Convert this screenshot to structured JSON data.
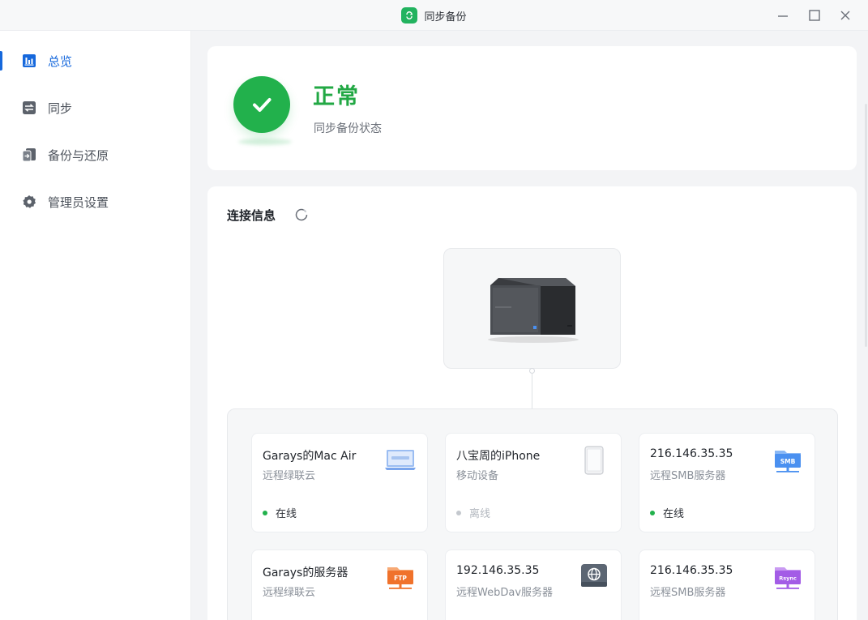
{
  "window": {
    "title": "同步备份",
    "controls": [
      "minimize-icon",
      "maximize-icon",
      "close-icon"
    ]
  },
  "sidebar": {
    "items": [
      {
        "label": "总览",
        "icon": "chart-icon",
        "active": true
      },
      {
        "label": "同步",
        "icon": "sync-icon",
        "active": false
      },
      {
        "label": "备份与还原",
        "icon": "backup-icon",
        "active": false
      },
      {
        "label": "管理员设置",
        "icon": "gear-icon",
        "active": false
      }
    ]
  },
  "status": {
    "value": "正常",
    "caption": "同步备份状态",
    "color": "#22b14c"
  },
  "connection": {
    "title": "连接信息",
    "devices": [
      {
        "name": "Garays的Mac Air",
        "type": "远程绿联云",
        "status": "在线",
        "online": true,
        "icon": "laptop-icon"
      },
      {
        "name": "八宝周的iPhone",
        "type": "移动设备",
        "status": "离线",
        "online": false,
        "icon": "phone-icon"
      },
      {
        "name": "216.146.35.35",
        "type": "远程SMB服务器",
        "status": "在线",
        "online": true,
        "icon": "smb-folder-icon",
        "badge": "SMB"
      },
      {
        "name": "Garays的服务器",
        "type": "远程绿联云",
        "status": "",
        "online": true,
        "icon": "ftp-folder-icon",
        "badge": "FTP"
      },
      {
        "name": "192.146.35.35",
        "type": "远程WebDav服务器",
        "status": "",
        "online": true,
        "icon": "globe-icon"
      },
      {
        "name": "216.146.35.35",
        "type": "远程SMB服务器",
        "status": "",
        "online": true,
        "icon": "rsync-folder-icon",
        "badge": "Rsync"
      }
    ]
  },
  "colors": {
    "accent": "#1668dc",
    "success": "#22b14c",
    "ftp": "#f0722b",
    "smb": "#4a90f0",
    "rsync": "#a35ce6"
  }
}
